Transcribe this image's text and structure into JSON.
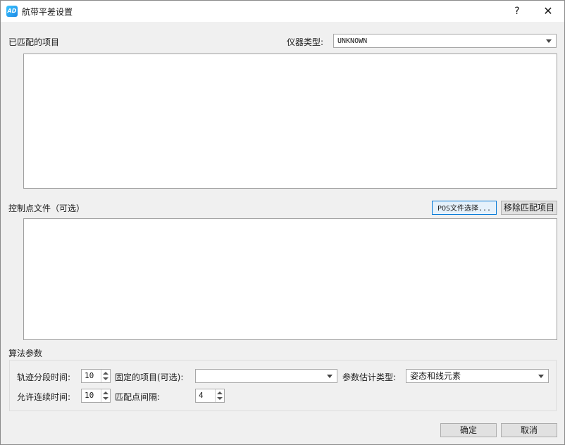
{
  "window": {
    "title": "航带平差设置",
    "help_label": "?",
    "close_label": "✕",
    "icon_text": "AD"
  },
  "matched": {
    "label": "已匹配的项目",
    "instrument_label": "仪器类型:",
    "instrument_value": "UNKNOWN"
  },
  "control": {
    "label": "控制点文件（可选）",
    "pos_button": "POS文件选择...",
    "remove_button": "移除匹配项目"
  },
  "algorithm": {
    "label": "算法参数",
    "segment_time_label": "轨迹分段时间:",
    "segment_time_value": "10",
    "fixed_items_label": "固定的项目(可选):",
    "fixed_items_value": "",
    "estimate_type_label": "参数估计类型:",
    "estimate_type_value": "姿态和线元素",
    "continuous_time_label": "允许连续时间:",
    "continuous_time_value": "10",
    "match_interval_label": "匹配点间隔:",
    "match_interval_value": "4"
  },
  "footer": {
    "ok": "确定",
    "cancel": "取消"
  }
}
